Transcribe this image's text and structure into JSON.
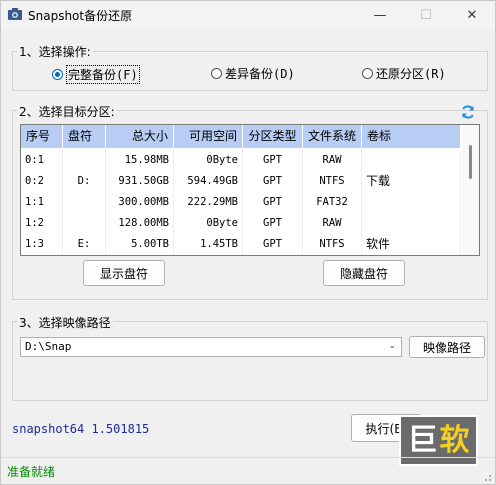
{
  "window": {
    "title": "Snapshot备份还原"
  },
  "operation": {
    "label": "1、选择操作:",
    "options": [
      {
        "label": "完整备份(F)",
        "checked": true
      },
      {
        "label": "差异备份(D)",
        "checked": false
      },
      {
        "label": "还原分区(R)",
        "checked": false
      }
    ]
  },
  "partition": {
    "label": "2、选择目标分区:",
    "columns": [
      "序号",
      "盘符",
      "总大小",
      "可用空间",
      "分区类型",
      "文件系统",
      "卷标"
    ],
    "rows": [
      {
        "no": "0:1",
        "drive": "",
        "size": "15.98MB",
        "free": "0Byte",
        "type": "GPT",
        "fs": "RAW",
        "label": ""
      },
      {
        "no": "0:2",
        "drive": "D:",
        "size": "931.50GB",
        "free": "594.49GB",
        "type": "GPT",
        "fs": "NTFS",
        "label": "下载"
      },
      {
        "no": "1:1",
        "drive": "",
        "size": "300.00MB",
        "free": "222.29MB",
        "type": "GPT",
        "fs": "FAT32",
        "label": ""
      },
      {
        "no": "1:2",
        "drive": "",
        "size": "128.00MB",
        "free": "0Byte",
        "type": "GPT",
        "fs": "RAW",
        "label": ""
      },
      {
        "no": "1:3",
        "drive": "E:",
        "size": "5.00TB",
        "free": "1.45TB",
        "type": "GPT",
        "fs": "NTFS",
        "label": "软件"
      }
    ],
    "show_button": "显示盘符",
    "hide_button": "隐藏盘符"
  },
  "image_path": {
    "label": "3、选择映像路径",
    "value": "D:\\Snap",
    "button": "映像路径"
  },
  "footer": {
    "version": "snapshot64 1.501815",
    "execute_button": "执行(E)",
    "status": "准备就绪"
  },
  "watermark": {
    "char1": "巨",
    "char2": "软"
  },
  "colors": {
    "header_bg": "#b7cdf3",
    "status_green": "#0a8a0a",
    "version_blue": "#1a2aa0",
    "radio_blue": "#0067c0"
  }
}
